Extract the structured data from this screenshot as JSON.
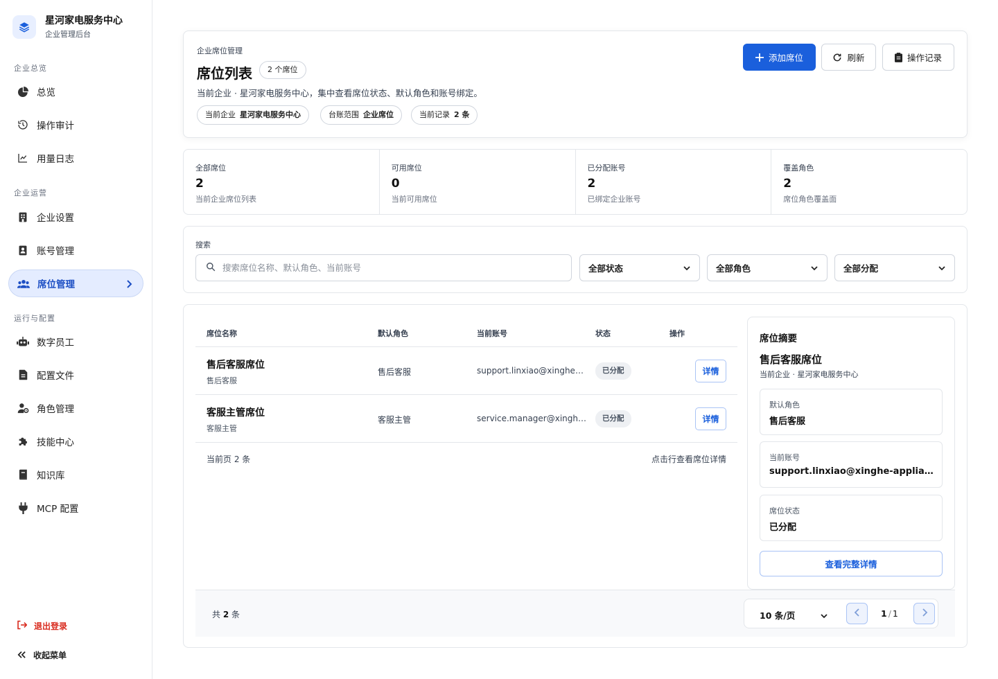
{
  "brand": {
    "name": "星河家电服务中心",
    "subtitle": "企业管理后台"
  },
  "sidebar": {
    "sections": [
      "企业总览",
      "企业运营",
      "运行与配置"
    ],
    "items": [
      {
        "label": "总览",
        "icon": "pie-chart-icon"
      },
      {
        "label": "操作审计",
        "icon": "history-icon"
      },
      {
        "label": "用量日志",
        "icon": "line-chart-icon"
      },
      {
        "label": "企业设置",
        "icon": "building-icon"
      },
      {
        "label": "账号管理",
        "icon": "id-card-icon"
      },
      {
        "label": "席位管理",
        "icon": "users-icon",
        "active": true
      },
      {
        "label": "数字员工",
        "icon": "robot-icon"
      },
      {
        "label": "配置文件",
        "icon": "file-icon"
      },
      {
        "label": "角色管理",
        "icon": "user-gear-icon"
      },
      {
        "label": "技能中心",
        "icon": "puzzle-icon"
      },
      {
        "label": "知识库",
        "icon": "book-icon"
      },
      {
        "label": "MCP 配置",
        "icon": "plug-icon"
      }
    ],
    "logout": "退出登录",
    "collapse": "收起菜单"
  },
  "header": {
    "eyebrow": "企业席位管理",
    "title": "席位列表",
    "count_pill": "2 个席位",
    "description": "当前企业 · 星河家电服务中心，集中查看席位状态、默认角色和账号绑定。",
    "chips": [
      {
        "key": "当前企业",
        "value": "星河家电服务中心"
      },
      {
        "key": "台账范围",
        "value": "企业席位"
      },
      {
        "key": "当前记录",
        "value": "2 条"
      }
    ],
    "buttons": {
      "add": "添加席位",
      "refresh": "刷新",
      "log": "操作记录"
    }
  },
  "stats": [
    {
      "label": "全部席位",
      "value": "2",
      "desc": "当前企业席位列表"
    },
    {
      "label": "可用席位",
      "value": "0",
      "desc": "当前可用席位"
    },
    {
      "label": "已分配账号",
      "value": "2",
      "desc": "已绑定企业账号"
    },
    {
      "label": "覆盖角色",
      "value": "2",
      "desc": "席位角色覆盖面"
    }
  ],
  "search": {
    "label": "搜索",
    "placeholder": "搜索席位名称、默认角色、当前账号",
    "filters": [
      "全部状态",
      "全部角色",
      "全部分配"
    ]
  },
  "table": {
    "headers": [
      "席位名称",
      "默认角色",
      "当前账号",
      "状态",
      "操作"
    ],
    "rows": [
      {
        "name": "售后客服席位",
        "sub": "售后客服",
        "role": "售后客服",
        "account": "support.linxiao@xinghe-appliance.com",
        "status": "已分配",
        "action": "详情"
      },
      {
        "name": "客服主管席位",
        "sub": "客服主管",
        "role": "客服主管",
        "account": "service.manager@xinghe-appliance.com",
        "status": "已分配",
        "action": "详情"
      }
    ],
    "footer_left": "当前页 2 条",
    "footer_right": "点击行查看席位详情"
  },
  "summary": {
    "heading": "席位摘要",
    "title": "售后客服席位",
    "subtitle": "当前企业 · 星河家电服务中心",
    "fields": [
      {
        "key": "默认角色",
        "value": "售后客服"
      },
      {
        "key": "当前账号",
        "value": "support.linxiao@xinghe-appliance.com"
      },
      {
        "key": "席位状态",
        "value": "已分配"
      }
    ],
    "button": "查看完整详情"
  },
  "pagination": {
    "total_prefix": "共",
    "total": "2",
    "total_suffix": "条",
    "page_size": "10 条/页",
    "current": "1",
    "pages": "1"
  },
  "colors": {
    "accent": "#1a5fdc",
    "danger": "#d92d20",
    "active_bg": "#e4ecff"
  }
}
